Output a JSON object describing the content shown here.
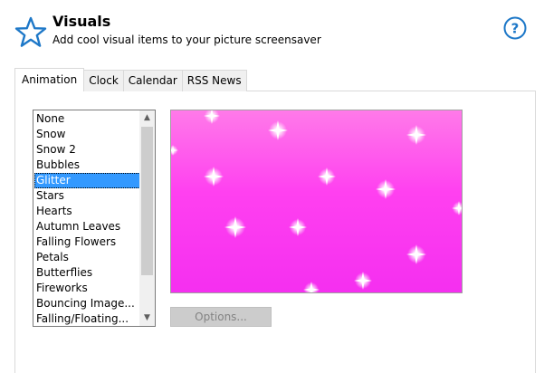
{
  "header": {
    "title": "Visuals",
    "subtitle": "Add cool visual items to your picture screensaver",
    "icon": "star-outline-icon",
    "help_icon": "help-icon",
    "help_label": "?",
    "accent_color": "#1e78c8"
  },
  "tabs": [
    {
      "label": "Animation",
      "active": true
    },
    {
      "label": "Clock",
      "active": false
    },
    {
      "label": "Calendar",
      "active": false
    },
    {
      "label": "RSS News",
      "active": false
    }
  ],
  "animation_list": {
    "items": [
      "None",
      "Snow",
      "Snow 2",
      "Bubbles",
      "Glitter",
      "Stars",
      "Hearts",
      "Autumn Leaves",
      "Falling Flowers",
      "Petals",
      "Butterflies",
      "Fireworks",
      "Bouncing Image...",
      "Falling/Floating..."
    ],
    "selected": "Glitter",
    "selection_color": "#3399ff"
  },
  "preview": {
    "effect": "glitter",
    "background_colors": [
      "#ff7ae9",
      "#f52ff0"
    ]
  },
  "options_button": {
    "label": "Options...",
    "enabled": false
  }
}
